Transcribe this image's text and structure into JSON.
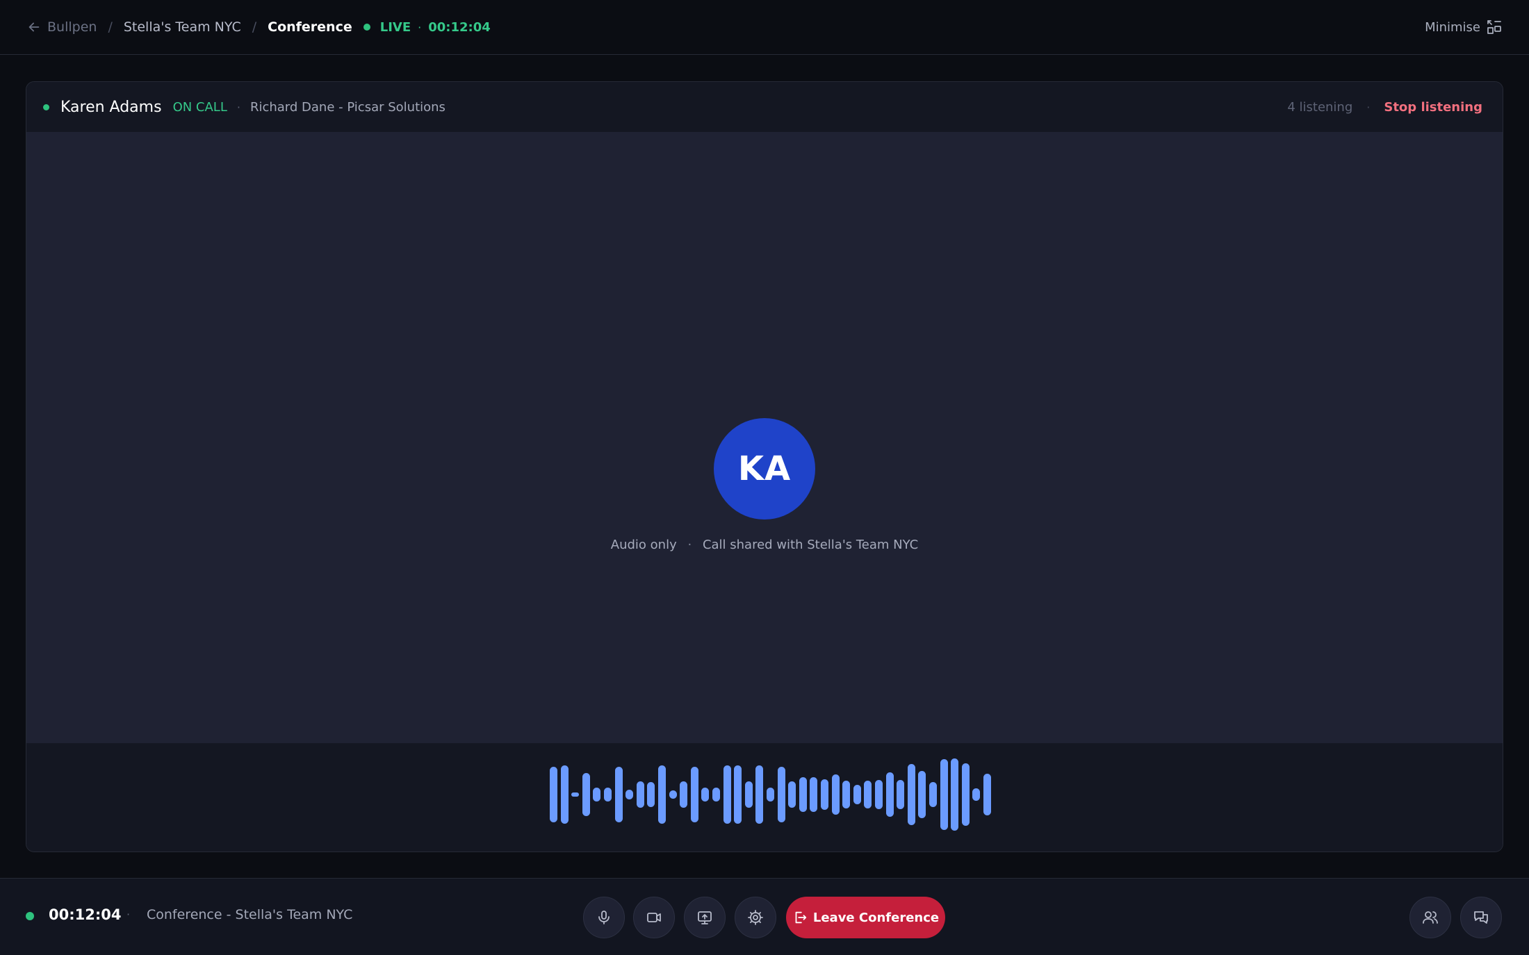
{
  "breadcrumb": {
    "back_label": "Bullpen",
    "separator": "/",
    "team": "Stella's Team NYC",
    "current": "Conference",
    "live_label": "LIVE",
    "live_separator": "·",
    "live_time": "00:12:04"
  },
  "topbar": {
    "minimise_label": "Minimise"
  },
  "call_header": {
    "caller_name": "Karen Adams",
    "status": "ON CALL",
    "separator": "·",
    "contact": "Richard Dane - Picsar Solutions",
    "listening": "4 listening",
    "separator2": "·",
    "stop_label": "Stop listening"
  },
  "stage": {
    "avatar_initials": "KA",
    "caption_left": "Audio only",
    "caption_separator": "·",
    "caption_right": "Call shared with Stella's Team NYC"
  },
  "waveform": {
    "levels": [
      0.76,
      0.8,
      0.06,
      0.6,
      0.2,
      0.2,
      0.76,
      0.14,
      0.36,
      0.34,
      0.8,
      0.12,
      0.36,
      0.76,
      0.2,
      0.2,
      0.8,
      0.8,
      0.36,
      0.8,
      0.2,
      0.76,
      0.36,
      0.48,
      0.48,
      0.42,
      0.56,
      0.38,
      0.26,
      0.38,
      0.4,
      0.62,
      0.4,
      0.84,
      0.66,
      0.34,
      0.98,
      1.0,
      0.86,
      0.18,
      0.58
    ]
  },
  "bottombar": {
    "time": "00:12:04",
    "separator": "·",
    "title": "Conference - Stella's Team NYC",
    "leave_label": "Leave Conference"
  },
  "colors": {
    "background": "#0b0d13",
    "stage": "#1f2233",
    "accent_green": "#35c98a",
    "avatar": "#1f43c9",
    "wave": "#6b9bff",
    "danger": "#c51f3b",
    "stop_text": "#f2707f"
  },
  "icons": {
    "back": "arrow-left-icon",
    "minimise": "minimise-icon",
    "mic": "microphone-icon",
    "video": "video-camera-icon",
    "share": "screen-share-icon",
    "settings": "gear-icon",
    "leave": "leave-door-icon",
    "participants": "participants-icon",
    "chat": "chat-icon"
  }
}
